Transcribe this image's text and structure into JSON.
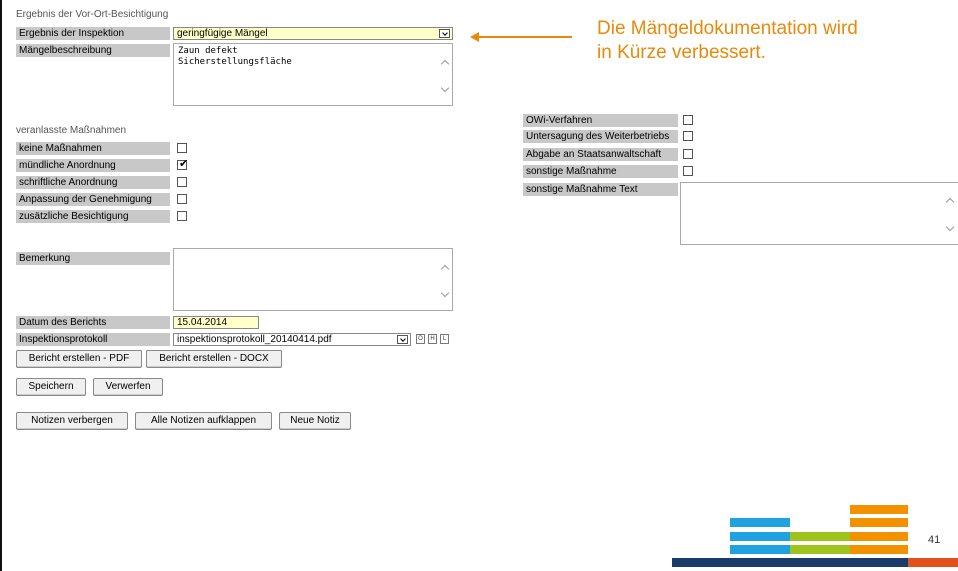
{
  "section_title": "Ergebnis der Vor-Ort-Besichtigung",
  "inspection": {
    "label": "Ergebnis der Inspektion",
    "value": "geringfügige Mängel"
  },
  "defects": {
    "label": "Mängelbeschreibung",
    "text": "Zaun defekt\nSicherstellungsfläche"
  },
  "measures": {
    "title": "veranlasste Maßnahmen",
    "items": [
      {
        "label": "keine Maßnahmen",
        "checked": false
      },
      {
        "label": "mündliche Anordnung",
        "checked": true
      },
      {
        "label": "schriftliche Anordnung",
        "checked": false
      },
      {
        "label": "Anpassung der Genehmigung",
        "checked": false
      },
      {
        "label": "zusätzliche Besichtigung",
        "checked": false
      }
    ]
  },
  "right_measures": {
    "items": [
      {
        "label": "OWi-Verfahren",
        "checked": false
      },
      {
        "label": "Untersagung des Weiterbetriebs",
        "checked": false
      },
      {
        "label": "Abgabe an Staatsanwaltschaft",
        "checked": false
      },
      {
        "label": "sonstige Maßnahme",
        "checked": false
      }
    ],
    "other_text_label": "sonstige Maßnahme Text",
    "other_text_value": ""
  },
  "remark": {
    "label": "Bemerkung",
    "text": ""
  },
  "report_date": {
    "label": "Datum des Berichts",
    "value": "15.04.2014"
  },
  "protocol": {
    "label": "Inspektionsprotokoll",
    "value": "inspektionsprotokoll_20140414.pdf",
    "icons": [
      "Ö",
      "H",
      "L"
    ]
  },
  "buttons": {
    "report_pdf": "Bericht erstellen - PDF",
    "report_docx": "Bericht erstellen - DOCX",
    "save": "Speichern",
    "discard": "Verwerfen",
    "hide_notes": "Notizen verbergen",
    "expand_notes": "Alle Notizen aufklappen",
    "new_note": "Neue Notiz"
  },
  "callout": {
    "line1": "Die Mängeldokumentation wird",
    "line2": "in Kürze verbessert.",
    "color": "#e8890c"
  },
  "slide_number": "41",
  "colors": {
    "label_bg": "#c8c8c8",
    "highlight_field": "#ffffc8",
    "blue": "#1fa3e0",
    "green": "#9fc31a",
    "orange": "#f39200",
    "navy": "#1a3a6b",
    "red": "#e2511c"
  }
}
